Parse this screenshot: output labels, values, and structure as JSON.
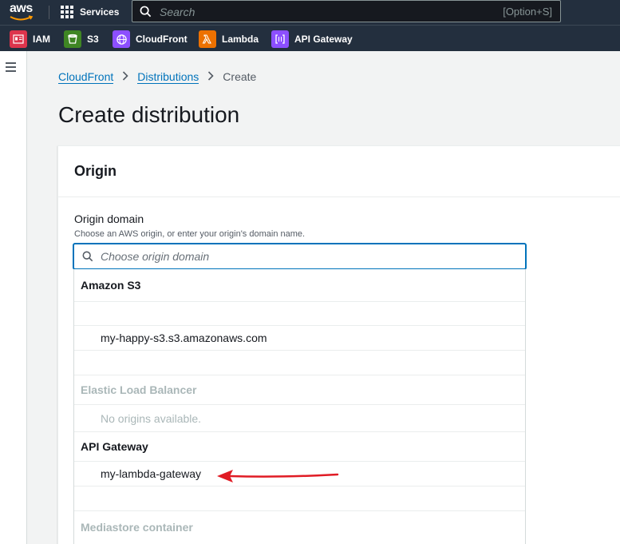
{
  "topnav": {
    "logo_text": "aws",
    "services_label": "Services",
    "search_placeholder": "Search",
    "search_shortcut": "[Option+S]"
  },
  "shortcuts": [
    {
      "label": "IAM",
      "color": "#dd344c",
      "icon": "iam-icon"
    },
    {
      "label": "S3",
      "color": "#3f8624",
      "icon": "s3-icon"
    },
    {
      "label": "CloudFront",
      "color": "#8c4fff",
      "icon": "cloudfront-icon"
    },
    {
      "label": "Lambda",
      "color": "#ed7100",
      "icon": "lambda-icon"
    },
    {
      "label": "API Gateway",
      "color": "#8c4fff",
      "icon": "api-gateway-icon"
    }
  ],
  "breadcrumb": {
    "item1": "CloudFront",
    "item2": "Distributions",
    "current": "Create"
  },
  "page_title": "Create distribution",
  "panel": {
    "title": "Origin",
    "field_label": "Origin domain",
    "field_description": "Choose an AWS origin, or enter your origin's domain name.",
    "combo_placeholder": "Choose origin domain"
  },
  "dropdown": {
    "groups": [
      {
        "label": "Amazon S3",
        "options": [
          "",
          "my-happy-s3.s3.amazonaws.com",
          ""
        ]
      },
      {
        "label": "Elastic Load Balancer",
        "disabled": true,
        "options": [
          "No origins available."
        ]
      },
      {
        "label": "API Gateway",
        "options": [
          "my-lambda-gateway",
          ""
        ]
      },
      {
        "label": "Mediastore container",
        "disabled": true,
        "options": []
      }
    ]
  },
  "colors": {
    "nav_bg": "#232f3e",
    "link": "#0073bb",
    "annotation_arrow": "#e01b24"
  }
}
